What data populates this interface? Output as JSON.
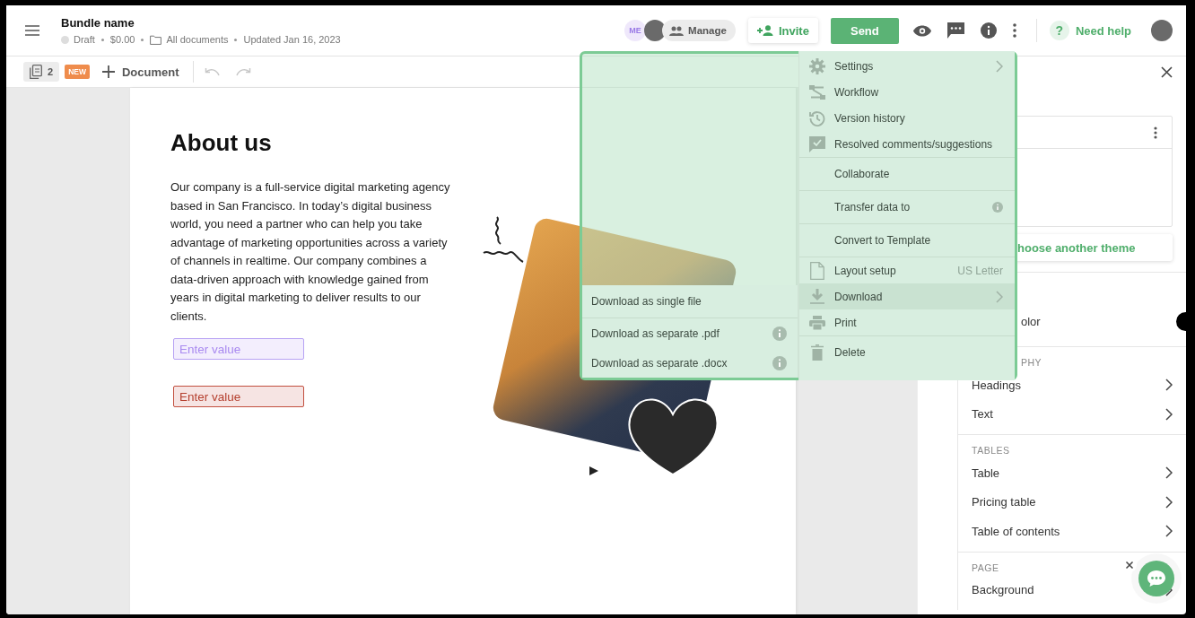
{
  "header": {
    "title": "Bundle name",
    "status": "Draft",
    "price": "$0.00",
    "folder": "All documents",
    "updated": "Updated Jan 16, 2023",
    "initials": "ME",
    "manage": "Manage",
    "invite": "Invite",
    "send": "Send",
    "help_mark": "?",
    "help": "Need help"
  },
  "toolbar": {
    "page_count": "2",
    "badge": "NEW",
    "add_document": "Document",
    "undo_disabled": true,
    "redo_disabled": true
  },
  "document": {
    "heading": "About us",
    "paragraph": "Our company is a full-service digital marketing agency based in San Francisco. In today’s digital business world, you need a partner who can help you take advantage of marketing opportunities across a variety of channels in realtime. Our company combines a data-driven approach with knowledge gained from years in digital marketing to deliver results to our clients.",
    "fields": [
      {
        "placeholder": "Enter value",
        "kind": "recipient"
      },
      {
        "placeholder": "Enter value",
        "kind": "error"
      }
    ]
  },
  "menu": {
    "groups": [
      [
        {
          "label": "Settings",
          "submenu": true,
          "info": false,
          "selected": false
        },
        {
          "label": "Workflow",
          "submenu": false,
          "info": false,
          "selected": false
        },
        {
          "label": "Version history",
          "submenu": false,
          "info": false,
          "selected": false
        },
        {
          "label": "Resolved comments/suggestions",
          "submenu": false,
          "info": false,
          "selected": false
        }
      ],
      [
        {
          "label": "Collaborate",
          "submenu": false,
          "info": false,
          "selected": false
        }
      ],
      [
        {
          "label": "Transfer data to",
          "submenu": false,
          "info": true,
          "selected": false
        }
      ],
      [
        {
          "label": "Convert to Template",
          "submenu": false,
          "info": false,
          "selected": false
        }
      ],
      [
        {
          "label": "Layout setup",
          "hint": "US Letter",
          "submenu": false,
          "info": false,
          "selected": false
        },
        {
          "label": "Download",
          "submenu": true,
          "info": false,
          "selected": true
        },
        {
          "label": "Print",
          "submenu": false,
          "info": false,
          "selected": false
        }
      ],
      [
        {
          "label": "Delete",
          "submenu": false,
          "info": false,
          "selected": false
        }
      ]
    ],
    "submenu": [
      [
        {
          "label": "Download as single file",
          "info": false
        }
      ],
      [
        {
          "label": "Download as separate .pdf",
          "info": true
        },
        {
          "label": "Download as separate .docx",
          "info": true
        }
      ]
    ]
  },
  "panel": {
    "theme_action": "hoose another theme",
    "color_label": "olor",
    "sections": [
      {
        "heading": "PHY",
        "items": [
          "Headings",
          "Text"
        ]
      },
      {
        "heading": "TABLES",
        "items": [
          "Table",
          "Pricing table",
          "Table of contents"
        ]
      },
      {
        "heading": "PAGE",
        "items": [
          "Background"
        ]
      }
    ]
  }
}
